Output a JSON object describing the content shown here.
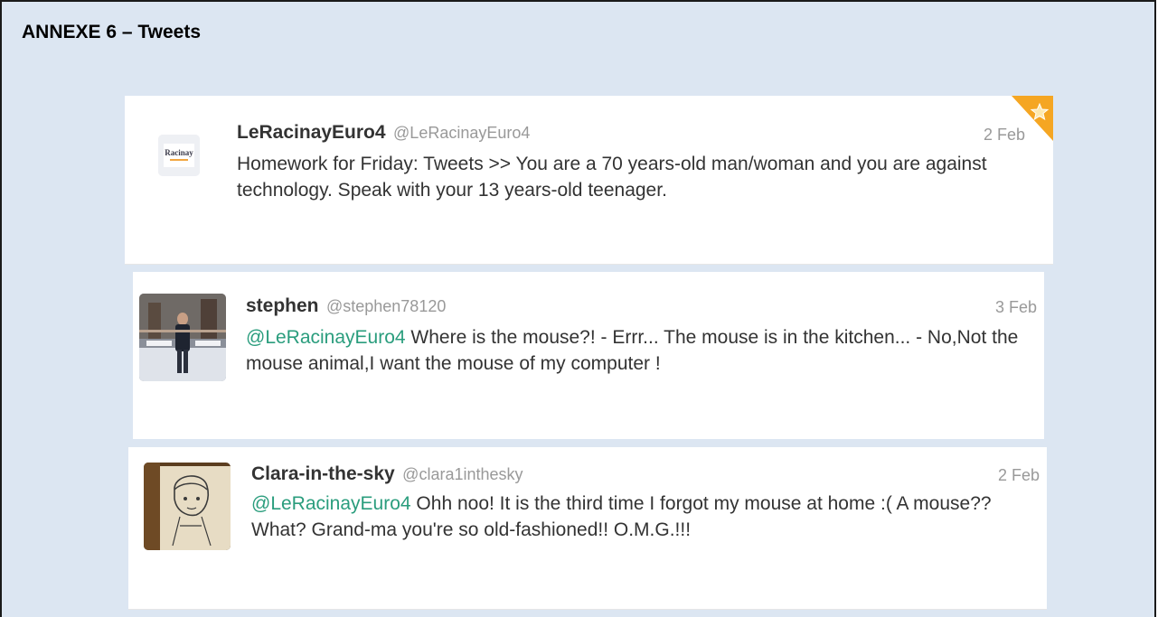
{
  "document": {
    "title": "ANNEXE 6 – Tweets"
  },
  "tweets": [
    {
      "name": "LeRacinayEuro4",
      "handle": "@LeRacinayEuro4",
      "date": "2 Feb",
      "mention": "",
      "text": "Homework for Friday: Tweets >> You are a 70 years-old man/woman and you are against technology. Speak with your 13 years-old teenager.",
      "avatar_icon": "racinay-logo-avatar",
      "avatar_text": "Racinay",
      "favorited": true
    },
    {
      "name": "stephen",
      "handle": "@stephen78120",
      "date": "3 Feb",
      "mention": "@LeRacinayEuro4",
      "text": " Where is the mouse?! - Errr... The mouse is in the kitchen... - No,Not the mouse animal,I want the mouse of my computer !",
      "avatar_icon": "snow-photo-avatar",
      "favorited": false
    },
    {
      "name": "Clara-in-the-sky",
      "handle": "@clara1inthesky",
      "date": "2 Feb",
      "mention": "@LeRacinayEuro4",
      "text": " Ohh noo! It is the third time I forgot my mouse at home :( A mouse?? What? Grand-ma you're so old-fashioned!! O.M.G.!!!",
      "avatar_icon": "sketch-drawing-avatar",
      "favorited": false
    }
  ],
  "colors": {
    "page_background": "#dce6f2",
    "mention": "#2a9d7d",
    "favorite_corner": "#f5a623"
  }
}
